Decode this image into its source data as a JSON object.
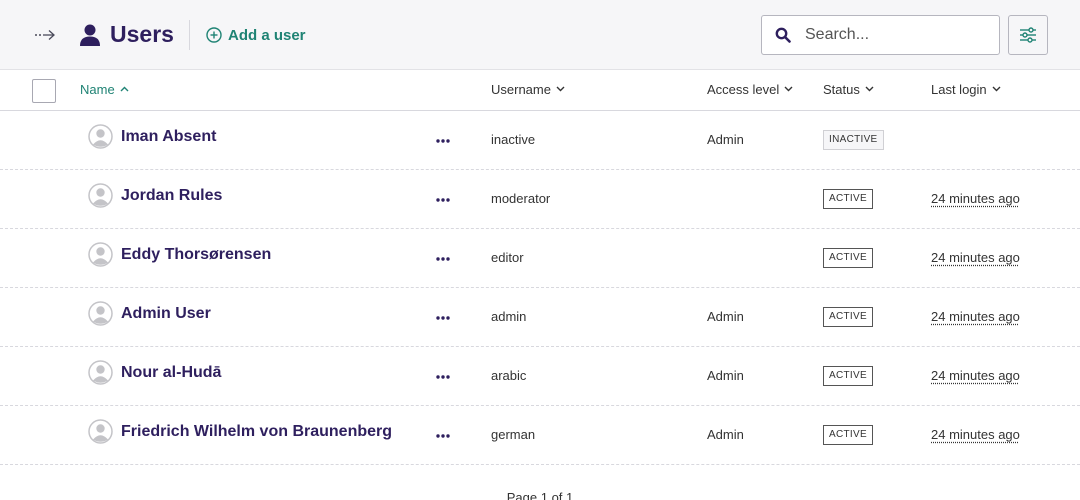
{
  "header": {
    "title": "Users",
    "add_user_label": "Add a user",
    "search_placeholder": "Search...",
    "accent_color": "#1f8374",
    "title_color": "#2e1f5e"
  },
  "table": {
    "columns": {
      "name": "Name",
      "username": "Username",
      "access": "Access level",
      "status": "Status",
      "last_login": "Last login"
    },
    "rows": [
      {
        "name": "Iman Absent",
        "username": "inactive",
        "access": "Admin",
        "status": "INACTIVE",
        "last_login": ""
      },
      {
        "name": "Jordan Rules",
        "username": "moderator",
        "access": "",
        "status": "ACTIVE",
        "last_login": "24 minutes ago"
      },
      {
        "name": "Eddy Thorsørensen",
        "username": "editor",
        "access": "",
        "status": "ACTIVE",
        "last_login": "24 minutes ago"
      },
      {
        "name": "Admin User",
        "username": "admin",
        "access": "Admin",
        "status": "ACTIVE",
        "last_login": "24 minutes ago"
      },
      {
        "name": "Nour al-Hudā",
        "username": "arabic",
        "access": "Admin",
        "status": "ACTIVE",
        "last_login": "24 minutes ago"
      },
      {
        "name": "Friedrich Wilhelm von Braunenberg",
        "username": "german",
        "access": "Admin",
        "status": "ACTIVE",
        "last_login": "24 minutes ago"
      }
    ]
  },
  "pagination": {
    "label": "Page 1 of 1"
  }
}
